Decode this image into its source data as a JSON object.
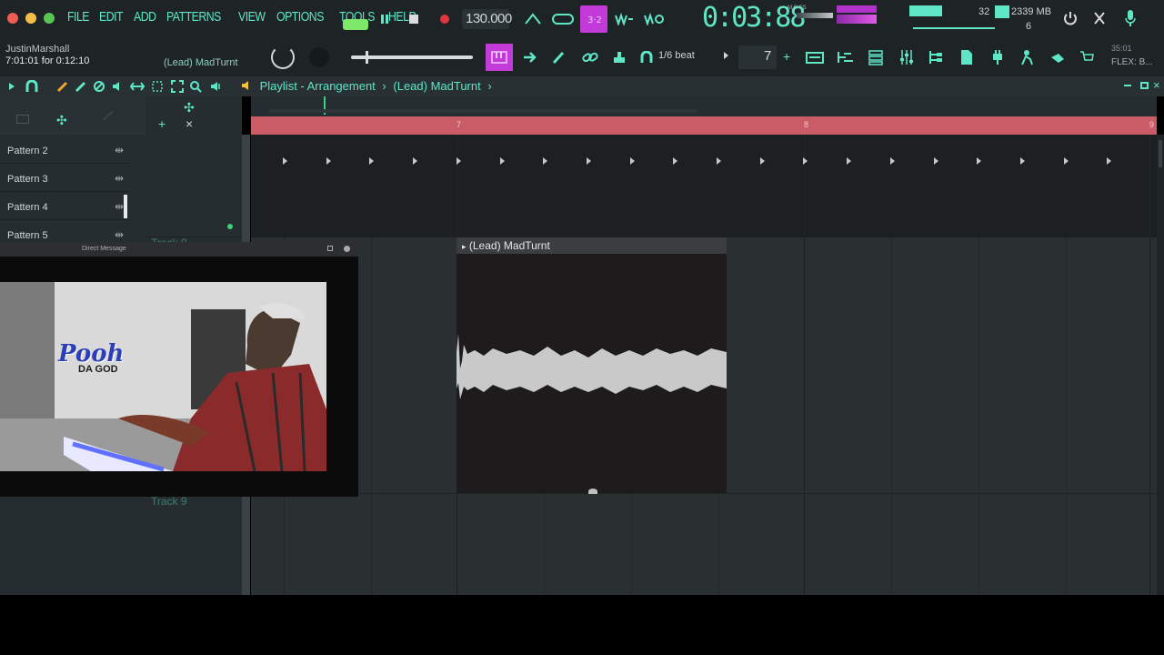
{
  "menu": {
    "items": [
      "FILE",
      "EDIT",
      "ADD",
      "PATTERNS",
      "VIEW",
      "OPTIONS",
      "TOOLS",
      "HELP"
    ]
  },
  "transport": {
    "tempo": "130.000",
    "time": "0:03:88",
    "time_unit": "M:S:CS",
    "mem_top": "32",
    "mem_value": "2339 MB",
    "mem_bottom": "6"
  },
  "hint_bar": {
    "user": "JustinMarshall",
    "time_line": "7:01:01 for 0:12:10",
    "pattern_name": "(Lead) MadTurnt"
  },
  "toolbar2": {
    "snap": "1/6 beat",
    "step": "7",
    "position": "35:01",
    "flex": "FLEX: B..."
  },
  "playlist": {
    "title": "Playlist - Arrangement",
    "separator": "›",
    "pattern": "(Lead) MadTurnt"
  },
  "patterns": [
    "Pattern 2",
    "Pattern 3",
    "Pattern 4",
    "Pattern 5"
  ],
  "ruler": {
    "bar_a": "7",
    "bar_b": "8",
    "bar_c": "9"
  },
  "tracks": {
    "track_8": "Track 8",
    "track_9": "Track 9"
  },
  "clip": {
    "name": "(Lead) MadTurnt"
  },
  "webcam": {
    "title": "Direct Message",
    "logo_main": "Pooh",
    "logo_sub": "DA GOD"
  },
  "colors": {
    "accent": "#5ee6c6",
    "magenta": "#c23ad8",
    "ruler": "#c95c66"
  }
}
